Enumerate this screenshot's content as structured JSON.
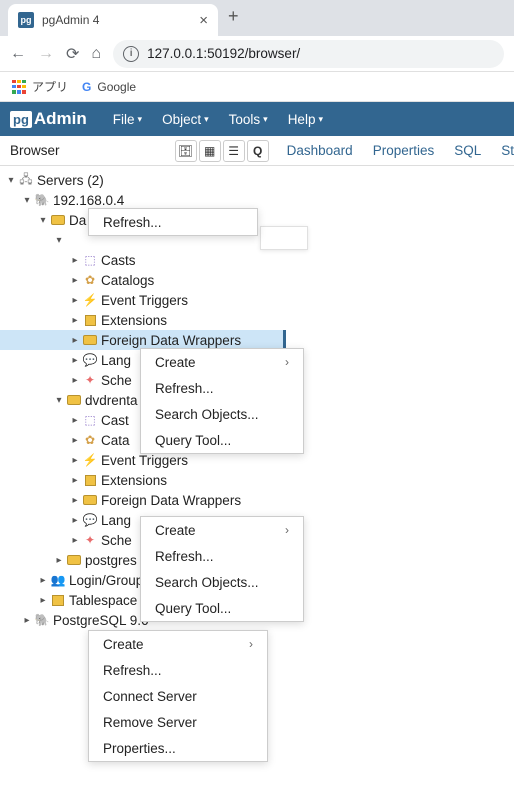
{
  "browser": {
    "tab_title": "pgAdmin 4",
    "url": "127.0.0.1:50192/browser/",
    "bookmarks": {
      "apps": "アプリ",
      "google": "Google"
    }
  },
  "pg": {
    "logo_pre": "pg",
    "logo_post": "Admin",
    "menus": {
      "file": "File",
      "object": "Object",
      "tools": "Tools",
      "help": "Help"
    }
  },
  "panel": {
    "browser": "Browser",
    "tabs": {
      "dashboard": "Dashboard",
      "properties": "Properties",
      "sql": "SQL",
      "st": "St"
    }
  },
  "tree": {
    "servers": "Servers (2)",
    "ip": "192.168.0.4",
    "da": "Da",
    "casts": "Casts",
    "catalogs": "Catalogs",
    "event_triggers": "Event Triggers",
    "extensions": "Extensions",
    "fdw": "Foreign Data Wrappers",
    "lang": "Lang",
    "sche": "Sche",
    "dvdrenta": "dvdrenta",
    "cast2": "Cast",
    "cata2": "Cata",
    "event2": "Event Triggers",
    "extensions2": "Extensions",
    "fdw2": "Foreign Data Wrappers",
    "lang2": "Lang",
    "sche2": "Sche",
    "postgres": "postgres",
    "login": "Login/Group",
    "tablespace": "Tablespace",
    "pgsql": "PostgreSQL 9.6"
  },
  "ctx_refresh": {
    "refresh": "Refresh..."
  },
  "ctx_fdw": {
    "create": "Create",
    "refresh": "Refresh...",
    "search": "Search Objects...",
    "query": "Query Tool..."
  },
  "ctx_db": {
    "create": "Create",
    "refresh": "Refresh...",
    "search": "Search Objects...",
    "query": "Query Tool..."
  },
  "ctx_srv": {
    "create": "Create",
    "refresh": "Refresh...",
    "connect": "Connect Server",
    "remove": "Remove Server",
    "properties": "Properties..."
  }
}
